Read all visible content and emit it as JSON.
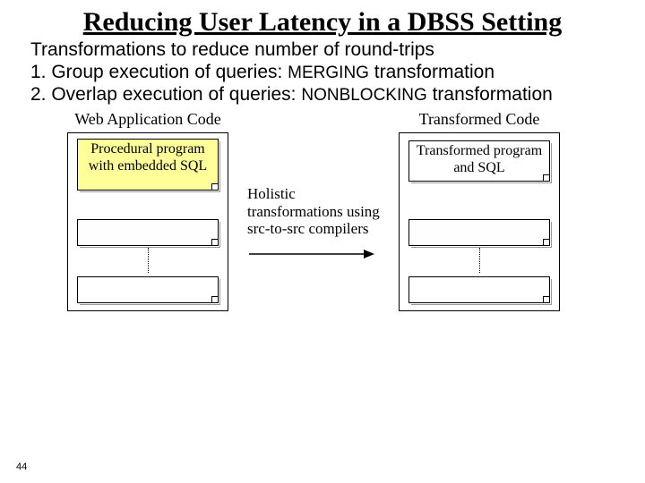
{
  "title": "Reducing User Latency in a DBSS Setting",
  "body": {
    "intro": "Transformations to reduce number of round-trips",
    "item1_pre": "1. Group execution of queries: ",
    "item1_kw": "MERGING",
    "item1_post": " transformation",
    "item2_pre": "2. Overlap execution of queries: ",
    "item2_kw": "NONBLOCKING",
    "item2_post": " transformation"
  },
  "diagram": {
    "left_label": "Web  Application Code",
    "right_label": "Transformed Code",
    "left_block": "Procedural program with embedded SQL",
    "right_block": "Transformed program and SQL",
    "middle": "Holistic transformations using src-to-src compilers"
  },
  "page_number": "44"
}
